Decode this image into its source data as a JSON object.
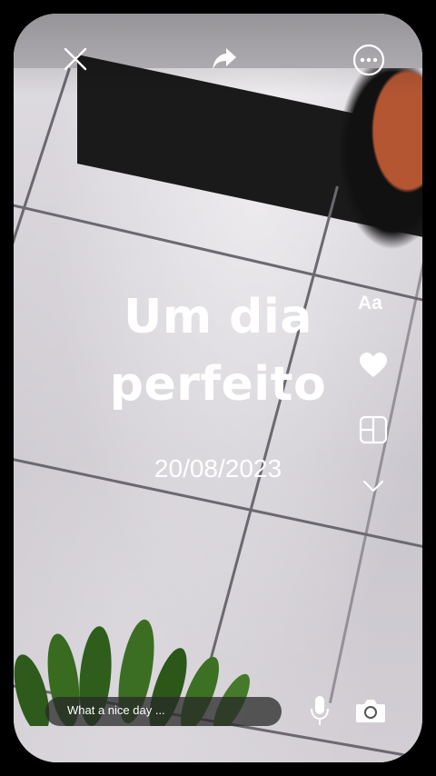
{
  "story": {
    "title": "Um dia perfeito",
    "date": "20/08/2023"
  },
  "toolbar": {
    "close_icon": "close-icon",
    "share_icon": "share-icon",
    "more_icon": "more-icon"
  },
  "side_tools": {
    "text_label": "Aa",
    "favorite_icon": "heart-icon",
    "layout_icon": "layout-icon",
    "expand_icon": "chevron-down-icon"
  },
  "bottom": {
    "caption_value": "What a nice day ...",
    "mic_icon": "microphone-icon",
    "camera_icon": "camera-icon"
  }
}
